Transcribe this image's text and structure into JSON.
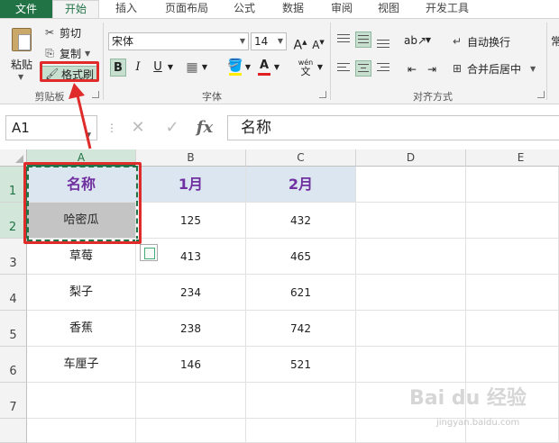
{
  "tabs": [
    "文件",
    "开始",
    "插入",
    "页面布局",
    "公式",
    "数据",
    "审阅",
    "视图",
    "开发工具"
  ],
  "clipboard": {
    "paste": "粘贴",
    "cut": "剪切",
    "copy": "复制",
    "format_painter": "格式刷",
    "group_label": "剪贴板"
  },
  "font": {
    "name": "宋体",
    "size": "14",
    "bold": "B",
    "italic": "I",
    "underline": "U",
    "phonetic": "wén",
    "group_label": "字体"
  },
  "alignment": {
    "wrap_text": "自动换行",
    "merge_center": "合并后居中",
    "group_label": "对齐方式",
    "next_group_cut": "常"
  },
  "formula_bar": {
    "cell_ref": "A1",
    "fx": "fx",
    "content": "名称"
  },
  "columns": [
    "A",
    "B",
    "C",
    "D",
    "E"
  ],
  "rows": [
    "1",
    "2",
    "3",
    "4",
    "5",
    "6",
    "7"
  ],
  "table": {
    "header": [
      "名称",
      "1月",
      "2月"
    ],
    "rows": [
      [
        "哈密瓜",
        "125",
        "432"
      ],
      [
        "草莓",
        "413",
        "465"
      ],
      [
        "梨子",
        "234",
        "621"
      ],
      [
        "香蕉",
        "238",
        "742"
      ],
      [
        "车厘子",
        "146",
        "521"
      ]
    ]
  },
  "colors": {
    "accent": "#217346",
    "header_fill": "#dce6f1",
    "header_text": "#7030a0",
    "highlight_fill": "#c4c4c4",
    "annotation": "#e02b2b"
  },
  "watermark": {
    "brand": "Bai du 经验",
    "url": "jingyan.baidu.com"
  }
}
